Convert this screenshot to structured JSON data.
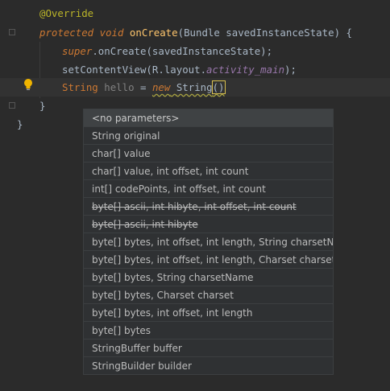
{
  "editor": {
    "line_override": "@Override",
    "line_oncreate": {
      "kw_protected": "protected",
      "kw_void": "void",
      "method": "onCreate",
      "params": "(Bundle savedInstanceState) {"
    },
    "line_super": {
      "kw_super": "super",
      "call": ".onCreate(savedInstanceState);"
    },
    "line_setcontent": {
      "call": "setContentView(R.layout.",
      "field": "activity_main",
      "end": ");"
    },
    "line_current": {
      "type": "String",
      "var": "hello",
      "eq": "=",
      "kw_new": "new",
      "ctor": "String",
      "parens": "()"
    },
    "close_inner": "}",
    "close_outer": "}"
  },
  "popup": {
    "items": [
      "<no parameters>",
      "String original",
      "char[] value",
      "char[] value, int offset, int count",
      "int[] codePoints, int offset, int count",
      "byte[] ascii, int hibyte, int offset, int count",
      "byte[] ascii, int hibyte",
      "byte[] bytes, int offset, int length, String charsetName",
      "byte[] bytes, int offset, int length, Charset charset",
      "byte[] bytes, String charsetName",
      "byte[] bytes, Charset charset",
      "byte[] bytes, int offset, int length",
      "byte[] bytes",
      "StringBuffer buffer",
      "StringBuilder builder"
    ]
  },
  "colors": {
    "background": "#2b2b2b",
    "keyword": "#cc7832",
    "annotation": "#bbb529",
    "method": "#ffc66d",
    "field": "#9876aa",
    "text": "#a9b7c6",
    "popup_bg": "#2f3133"
  },
  "icons": {
    "bulb": "lightbulb-icon",
    "fold": "fold-marker-icon"
  }
}
